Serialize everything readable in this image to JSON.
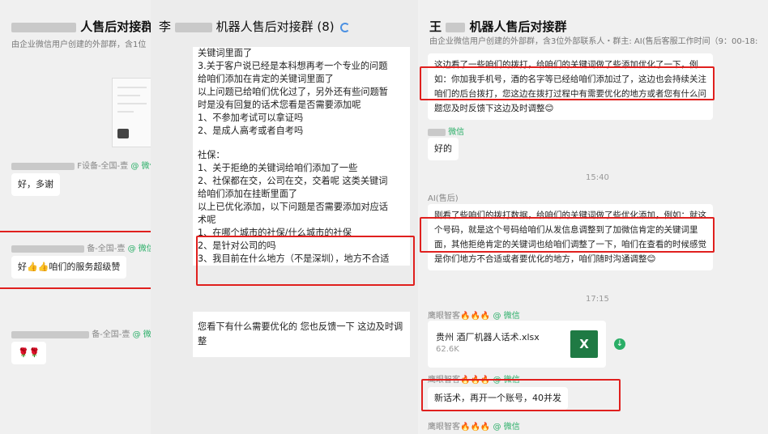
{
  "panel1": {
    "title": "人售后对接群",
    "subtitle": "由企业微信用户创建的外部群，含1位",
    "messages": [
      {
        "sender": "F设备-全国-壹",
        "tag": "@ 微信",
        "text": "好，多谢"
      },
      {
        "sender": "备-全国-壹",
        "tag": "@ 微信",
        "text": "好👍👍咱们的服务超级赞"
      },
      {
        "sender": "备-全国-壹",
        "tag": "@ 微信",
        "text": "🌹🌹"
      }
    ]
  },
  "panel2": {
    "title_prefix": "李",
    "title": "机器人售后对接群 (8)",
    "doc_lines": [
      "关键词里面了",
      "3.关于客户说已经是本科想再考一个专业的问题",
      "给咱们添加在肯定的关键词里面了",
      "以上问题已给咱们优化过了，另外还有些问题暂",
      "时是没有回复的话术您看是否需要添加呢",
      "1、不参加考试可以拿证吗",
      "2、是成人高考或者自考吗",
      "",
      "社保：",
      "1、关于拒绝的关键词给咱们添加了一些",
      "2、社保都在交，公司在交，交着呢 这类关键词",
      "给咱们添加在挂断里面了",
      "以上已优化添加，以下问题是否需要添加对应话",
      "术呢",
      "1、在哪个城市的社保/什么城市的社保",
      "2、是针对公司的吗",
      "3、我目前在什么地方（不是深圳），地方不合适"
    ],
    "doc2_text": "您看下有什么需要优化的   您也反馈一下  这边及时调整"
  },
  "panel3": {
    "title_prefix": "王",
    "title": "机器人售后对接群",
    "subtitle": "由企业微信用户创建的外部群，含3位外部联系人・群主: AI(售后客服工作时间（9：00-18:",
    "bubble1": "这边看了一些咱们的拨打，给咱们的关键词做了些添加优化了一下，例如：你加我手机号，酒的名字等已经给咱们添加过了，这边也会持续关注咱们的后台拨打，您这边在拨打过程中有需要优化的地方或者您有什么问题您及时反馈下这边及时调整😊",
    "sender2": "微信",
    "bubble2": "好的",
    "time1": "15:40",
    "sender3": "AI(售后)",
    "bubble3": "刚看了些咱们的拨打数据，给咱们的关键词做了些优化添加，例如：就这个号码，就是这个号码给咱们从发信息调整到了加微信肯定的关键词里面，其他拒绝肯定的关键词也给咱们调整了一下，咱们在查看的时候感觉是你们地方不合适或者要优化的地方，咱们随时沟通调整😊",
    "time2": "17:15",
    "sender4": "鹰眼智客🔥🔥🔥",
    "sender4_tag": "@ 微信",
    "file_name": "贵州 酒厂机器人话术.xlsx",
    "file_size": "62.6K",
    "file_icon": "X",
    "bubble5": "新话术，再开一个账号，40并发",
    "accent_red": "#e0201e"
  }
}
